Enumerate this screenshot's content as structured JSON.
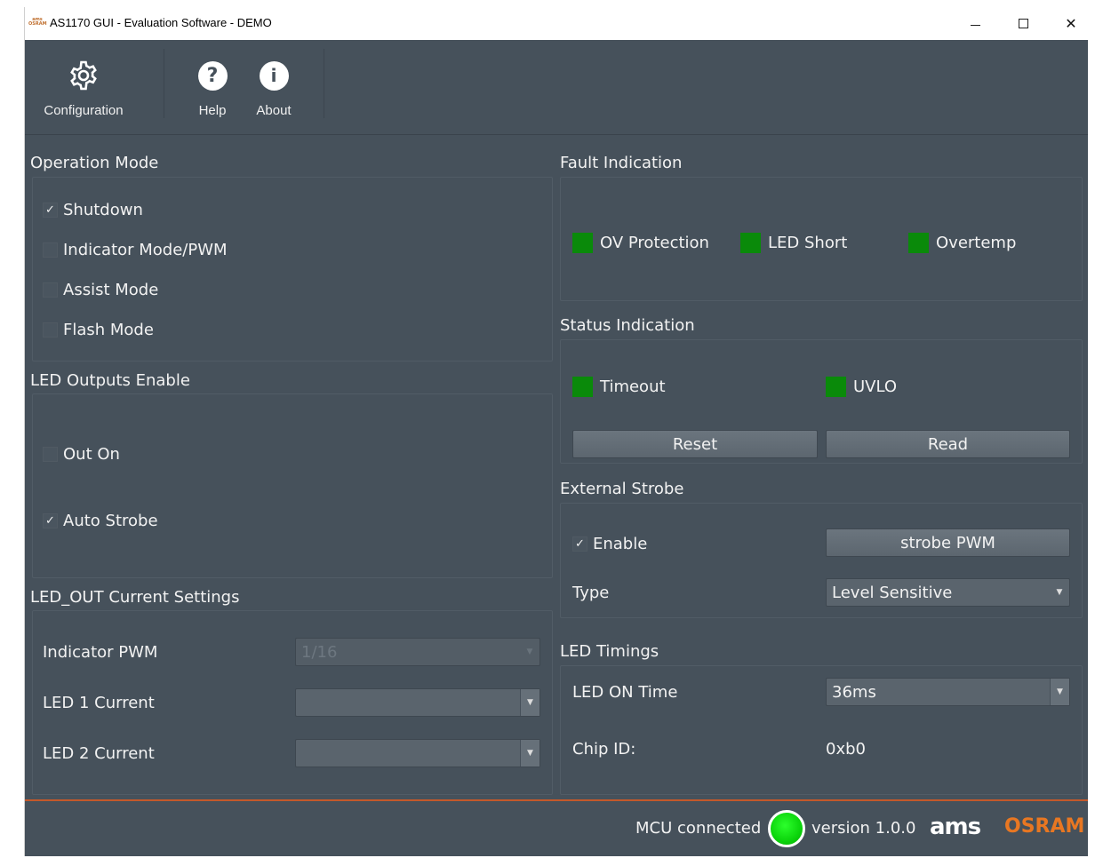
{
  "window": {
    "title": "AS1170 GUI - Evaluation Software - DEMO",
    "logo_text": "ams OSRAM"
  },
  "toolbar": {
    "configuration_label": "Configuration",
    "help_label": "Help",
    "about_label": "About"
  },
  "operation_mode": {
    "title": "Operation Mode",
    "items": [
      {
        "label": "Shutdown",
        "checked": true,
        "mark": "✓"
      },
      {
        "label": "Indicator Mode/PWM",
        "checked": false,
        "mark": ""
      },
      {
        "label": "Assist Mode",
        "checked": false,
        "mark": ""
      },
      {
        "label": "Flash Mode",
        "checked": false,
        "mark": ""
      }
    ]
  },
  "led_outputs": {
    "title": "LED Outputs Enable",
    "items": [
      {
        "label": "Out On",
        "checked": false,
        "mark": ""
      },
      {
        "label": "Auto Strobe",
        "checked": true,
        "mark": "✓"
      }
    ]
  },
  "current_settings": {
    "title": "LED_OUT Current Settings",
    "indicator_pwm_label": "Indicator PWM",
    "indicator_pwm_value": "1/16",
    "led1_label": "LED 1 Current",
    "led1_value": "",
    "led2_label": "LED 2 Current",
    "led2_value": ""
  },
  "fault_indication": {
    "title": "Fault Indication",
    "items": [
      "OV Protection",
      "LED Short",
      "Overtemp"
    ],
    "color": "#0a8a0a"
  },
  "status_indication": {
    "title": "Status Indication",
    "timeout_label": "Timeout",
    "uvlo_label": "UVLO",
    "reset_label": "Reset",
    "read_label": "Read"
  },
  "external_strobe": {
    "title": "External Strobe",
    "enable_label": "Enable",
    "enable_mark": "✓",
    "strobe_pwm_label": "strobe PWM",
    "type_label": "Type",
    "type_value": "Level Sensitive"
  },
  "led_timings": {
    "title": "LED Timings",
    "on_time_label": "LED ON Time",
    "on_time_value": "36ms",
    "chip_id_label": "Chip ID:",
    "chip_id_value": "0xb0"
  },
  "status_bar": {
    "mcu_label": "MCU connected",
    "version": "version 1.0.0",
    "brand_ams": "ams",
    "brand_osram": "OSRAM",
    "accent": "#c4582a"
  }
}
